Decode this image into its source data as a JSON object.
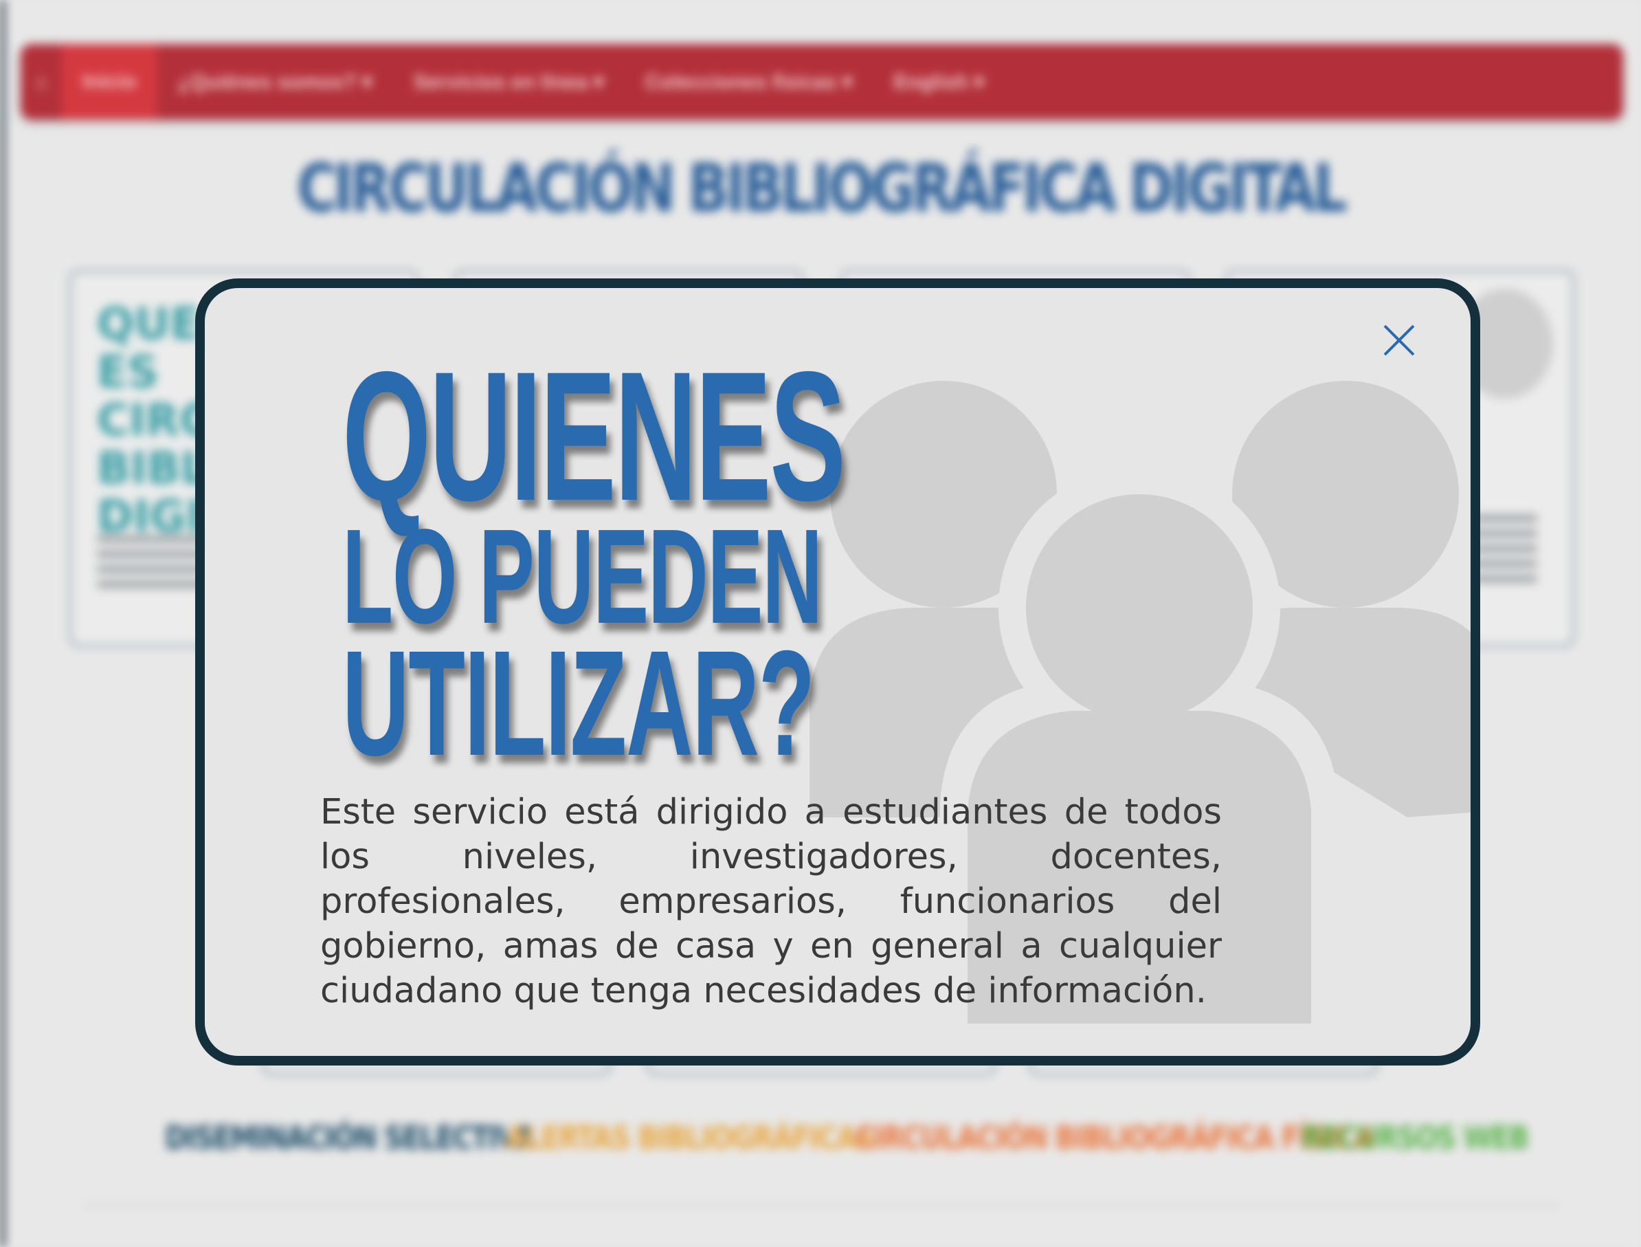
{
  "background": {
    "nav": {
      "home_icon": "home-icon",
      "items": [
        {
          "label": "Inicio",
          "active": true
        },
        {
          "label": "¿Quiénes somos? ▾"
        },
        {
          "label": "Servicios en línea ▾"
        },
        {
          "label": "Colecciones físicas ▾"
        },
        {
          "label": "English ▾"
        }
      ],
      "color": "#b3303a"
    },
    "title": "CIRCULACIÓN BIBLIOGRÁFICA DIGITAL",
    "card_heading": "QUE ES CIRCULACIÓN BIBLIOGRÁFICA DIGITAL",
    "links": [
      {
        "label": "DISEMINACIÓN SELECTIVA",
        "color": "#1f4f6b"
      },
      {
        "label": "ALERTAS BIBLIOGRÁFICAS",
        "color": "#e8a640"
      },
      {
        "label": "CIRCULACIÓN BIBLIOGRÁFICA FÍSICA",
        "color": "#e9773f"
      },
      {
        "label": "RECURSOS WEB",
        "color": "#5bb44d"
      }
    ]
  },
  "modal": {
    "close_icon": "close-icon",
    "heading": {
      "line1": "QUIENES",
      "line2": "LO PUEDEN",
      "line3": "UTILIZAR?"
    },
    "body": "Este servicio está dirigido a estudiantes de todos los niveles, investigadores, docentes, profesionales, empresarios, funcionarios del gobierno, amas de casa y en general a cualquier ciudadano que tenga necesidades de información.",
    "illustration_icon": "users-group-icon",
    "colors": {
      "heading": "#2a6bb0",
      "border": "#14303d",
      "close": "#2a6bb0",
      "illustration": "#d0d0d0"
    }
  }
}
